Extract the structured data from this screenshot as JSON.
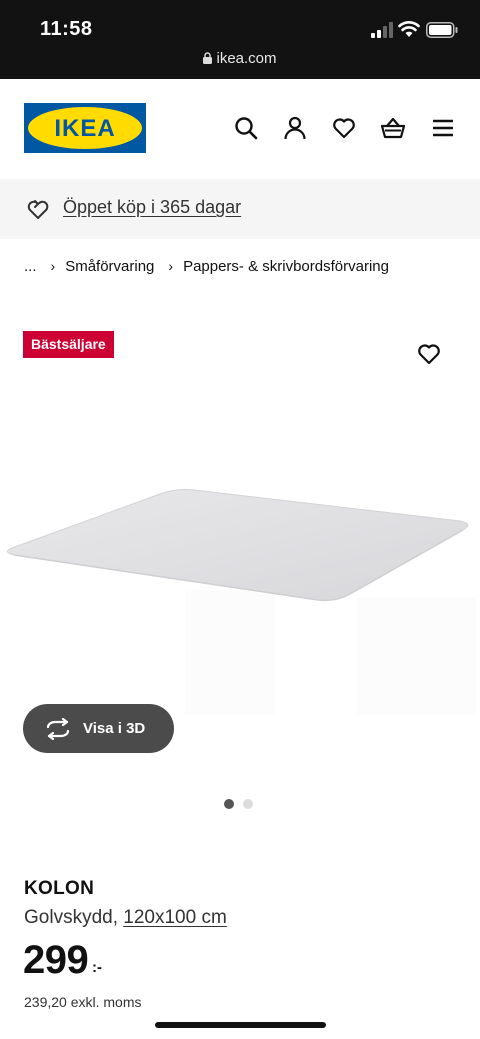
{
  "status_bar": {
    "time": "11:58",
    "url": "ikea.com",
    "icons": [
      "signal-icon",
      "wifi-icon",
      "battery-icon",
      "lock-icon"
    ]
  },
  "header": {
    "logo_text": "IKEA",
    "icons": [
      "search-icon",
      "user-icon",
      "heart-icon",
      "basket-icon",
      "menu-icon"
    ]
  },
  "returns_banner": {
    "text": "Öppet köp i 365 dagar",
    "icon": "return-arrow-icon"
  },
  "breadcrumb": {
    "items": [
      "...",
      "Småförvaring",
      "Pappers- & skrivbordsförvaring"
    ],
    "separator": "›"
  },
  "product": {
    "badge": "Bästsäljare",
    "view_3d_label": "Visa i 3D",
    "image_count": 2,
    "active_image": 1,
    "name": "KOLON",
    "description": "Golvskydd,",
    "dimensions": "120x100 cm",
    "price": "299",
    "price_suffix": ":-",
    "price_excl_vat": "239,20 exkl. moms"
  },
  "colors": {
    "ikea_blue": "#0058a3",
    "ikea_yellow": "#ffdb00",
    "badge_red": "#cc0033",
    "status_bar_bg": "#121212",
    "banner_bg": "#f5f5f5"
  }
}
